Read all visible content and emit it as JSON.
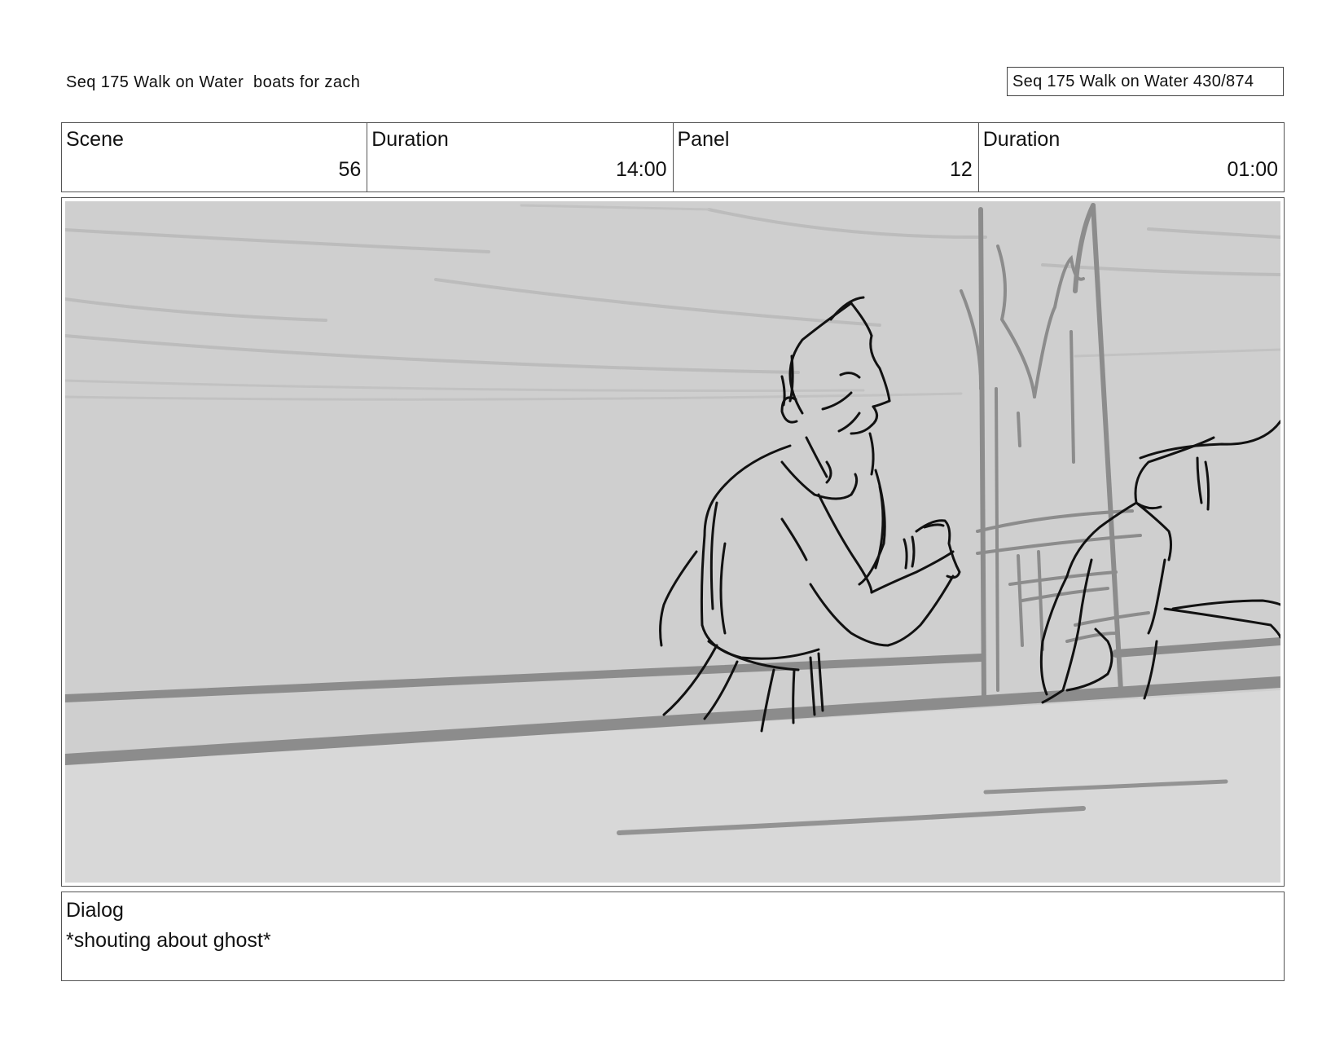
{
  "header": {
    "title": "Seq 175 Walk on Water  boats for zach",
    "page_info": "Seq 175 Walk on Water 430/874"
  },
  "info": {
    "scene_label": "Scene",
    "scene_value": "56",
    "scene_duration_label": "Duration",
    "scene_duration_value": "14:00",
    "panel_label": "Panel",
    "panel_value": "12",
    "panel_duration_label": "Duration",
    "panel_duration_value": "01:00"
  },
  "panel": {
    "image_description": "storyboard-sketch-man-leaning-on-boat-railing"
  },
  "dialog": {
    "label": "Dialog",
    "text": "*shouting about ghost*"
  },
  "colors": {
    "sketch_background": "#cfcfcf",
    "sketch_deck": "#d8d8d8",
    "sketch_lines": "#111111",
    "sketch_shading": "#8c8c8c"
  }
}
